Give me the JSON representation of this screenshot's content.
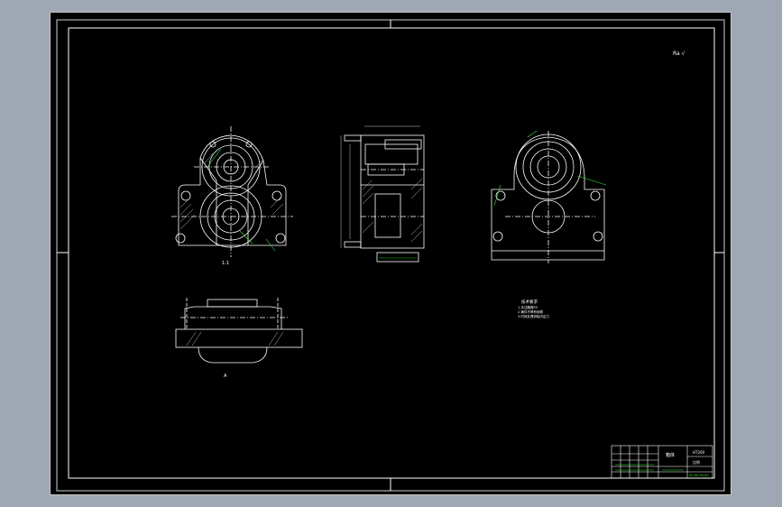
{
  "drawing": {
    "roughness_mark": "Ra √",
    "view_label_front": "1:1",
    "view_label_bottom": "A",
    "notes": {
      "heading": "技术要求",
      "lines": [
        "1.未注圆角R3",
        "2.铸件不得有砂眼",
        "3.时效处理消除内应力"
      ]
    }
  },
  "title_block": {
    "part_name": "箱体",
    "material": "HT200",
    "scale": "比例",
    "drawing_no": "00-00-00-00"
  },
  "colors": {
    "background": "#000000",
    "line": "#ffffff",
    "dimension": "#22ee22",
    "hatch": "#cccccc",
    "frame": "#9ea7b3"
  }
}
